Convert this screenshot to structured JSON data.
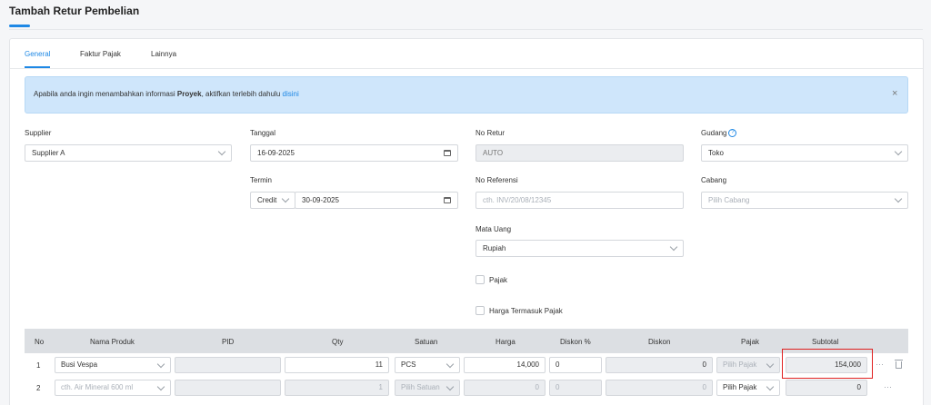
{
  "page": {
    "title": "Tambah Retur Pembelian"
  },
  "tabs": [
    {
      "label": "General",
      "active": true
    },
    {
      "label": "Faktur Pajak",
      "active": false
    },
    {
      "label": "Lainnya",
      "active": false
    }
  ],
  "alert": {
    "text_before": "Apabila anda ingin menambahkan informasi ",
    "bold": "Proyek",
    "text_after": ", aktifkan terlebih dahulu ",
    "link": "disini"
  },
  "form": {
    "supplier": {
      "label": "Supplier",
      "value": "Supplier A"
    },
    "tanggal": {
      "label": "Tanggal",
      "value": "16-09-2025"
    },
    "no_retur": {
      "label": "No Retur",
      "value": "AUTO"
    },
    "gudang": {
      "label": "Gudang",
      "value": "Toko"
    },
    "termin": {
      "label": "Termin",
      "type": "Credit",
      "value": "30-09-2025"
    },
    "no_referensi": {
      "label": "No Referensi",
      "placeholder": "cth. INV/20/08/12345"
    },
    "cabang": {
      "label": "Cabang",
      "placeholder": "Pilih Cabang"
    },
    "mata_uang": {
      "label": "Mata Uang",
      "value": "Rupiah"
    },
    "pajak": {
      "label": "Pajak",
      "checked": false
    },
    "harga_termasuk_pajak": {
      "label": "Harga Termasuk Pajak",
      "checked": false
    }
  },
  "table": {
    "headers": [
      "No",
      "Nama Produk",
      "PID",
      "Qty",
      "Satuan",
      "Harga",
      "Diskon %",
      "Diskon",
      "Pajak",
      "Subtotal"
    ],
    "rows": [
      {
        "no": "1",
        "produk": "Busi Vespa",
        "pid": "",
        "qty": "11",
        "satuan": "PCS",
        "harga": "14,000",
        "diskon_pct": "0",
        "diskon": "0",
        "pajak": "Pilih Pajak",
        "subtotal": "154,000"
      },
      {
        "no": "2",
        "produk": "cth. Air Mineral 600 ml",
        "pid": "",
        "qty": "1",
        "satuan": "Pilih Satuan",
        "harga": "0",
        "diskon_pct": "0",
        "diskon": "0",
        "pajak": "Pilih Pajak",
        "subtotal": "0"
      }
    ]
  },
  "colors": {
    "accent": "#1e88e5",
    "alert_bg": "#cfe6fb",
    "highlight": "#e02020"
  }
}
